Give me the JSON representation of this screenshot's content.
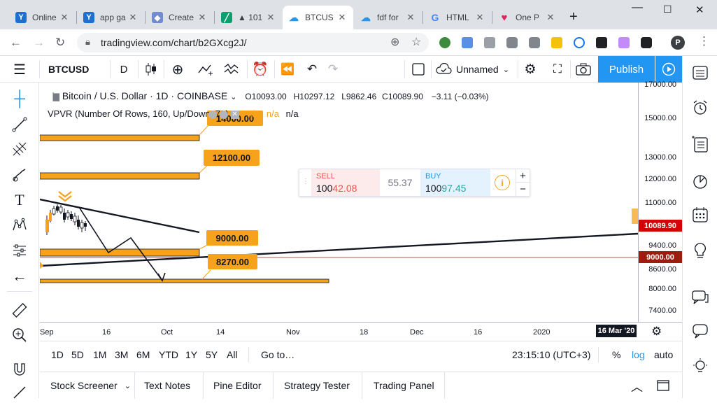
{
  "browser": {
    "tabs": [
      {
        "title": "Online",
        "icon": "y-icon",
        "color": "#1f6fd0",
        "glyph": "Y"
      },
      {
        "title": "app ga",
        "icon": "y-icon",
        "color": "#1f6fd0",
        "glyph": "Y"
      },
      {
        "title": "Create",
        "icon": "puzzle-icon",
        "color": "#6f8cd0",
        "glyph": "◆"
      },
      {
        "title": "▲ 101",
        "icon": "chart-icon",
        "color": "#0e9f6e",
        "glyph": "╱"
      },
      {
        "title": "BTCUS",
        "icon": "tradingview-icon",
        "color": "#2196f3",
        "glyph": "☁"
      },
      {
        "title": "fdf for",
        "icon": "tradingview-icon",
        "color": "#2196f3",
        "glyph": "☁"
      },
      {
        "title": "HTML",
        "icon": "google-icon",
        "color": "#ffffff",
        "glyph": "G"
      },
      {
        "title": "One P",
        "icon": "heart-icon",
        "color": "#ffffff",
        "glyph": "♥"
      }
    ],
    "url": "tradingview.com/chart/b2GXcg2J/",
    "profile_initial": "P"
  },
  "header": {
    "symbol": "BTCUSD",
    "interval": "D",
    "layout_name": "Unnamed",
    "publish_label": "Publish"
  },
  "legend": {
    "title": "Bitcoin / U.S. Dollar · 1D · COINBASE",
    "open": "O10093.00",
    "high": "H10297.12",
    "low": "L9862.46",
    "close": "C10089.90",
    "change": "−3.11 (−0.03%)",
    "indicator": "VPVR (Number Of Rows, 160, Up/Down, 70)",
    "na1": "n/a",
    "na2": "n/a",
    "na3": "n/a"
  },
  "trade": {
    "sell_label": "SELL",
    "sell_price_a": "100",
    "sell_price_b": "42.08",
    "spread": "55.37",
    "buy_label": "BUY",
    "buy_price_a": "100",
    "buy_price_b": "97.45"
  },
  "chart_data": {
    "type": "candlestick",
    "symbol": "BTCUSD",
    "y_axis_scale": "log",
    "price_ticks": [
      "17000.00",
      "15000.00",
      "13000.00",
      "12000.00",
      "11000.00",
      "9400.00",
      "8600.00",
      "8000.00",
      "7400.00"
    ],
    "time_ticks": [
      "Sep",
      "16",
      "Oct",
      "14",
      "Nov",
      "18",
      "Dec",
      "16",
      "2020"
    ],
    "last_price_label": "10089.90",
    "crosshair_price_label": "9000.00",
    "crosshair_date_label": "16 Mar '20",
    "annotations": [
      "14000.00",
      "12100.00",
      "9000.00",
      "8270.00"
    ]
  },
  "ranges": [
    "1D",
    "5D",
    "1M",
    "3M",
    "6M",
    "YTD",
    "1Y",
    "5Y",
    "All"
  ],
  "goto_label": "Go to…",
  "clock": "23:15:10 (UTC+3)",
  "scale": {
    "percent": "%",
    "log": "log",
    "auto": "auto"
  },
  "bottom_tabs": [
    "Stock Screener",
    "Text Notes",
    "Pine Editor",
    "Strategy Tester",
    "Trading Panel"
  ],
  "colors": {
    "accent": "#2196f3",
    "orange": "#f7a21b",
    "red_label": "#d50000",
    "crosshair_label": "#9c1c0e"
  }
}
